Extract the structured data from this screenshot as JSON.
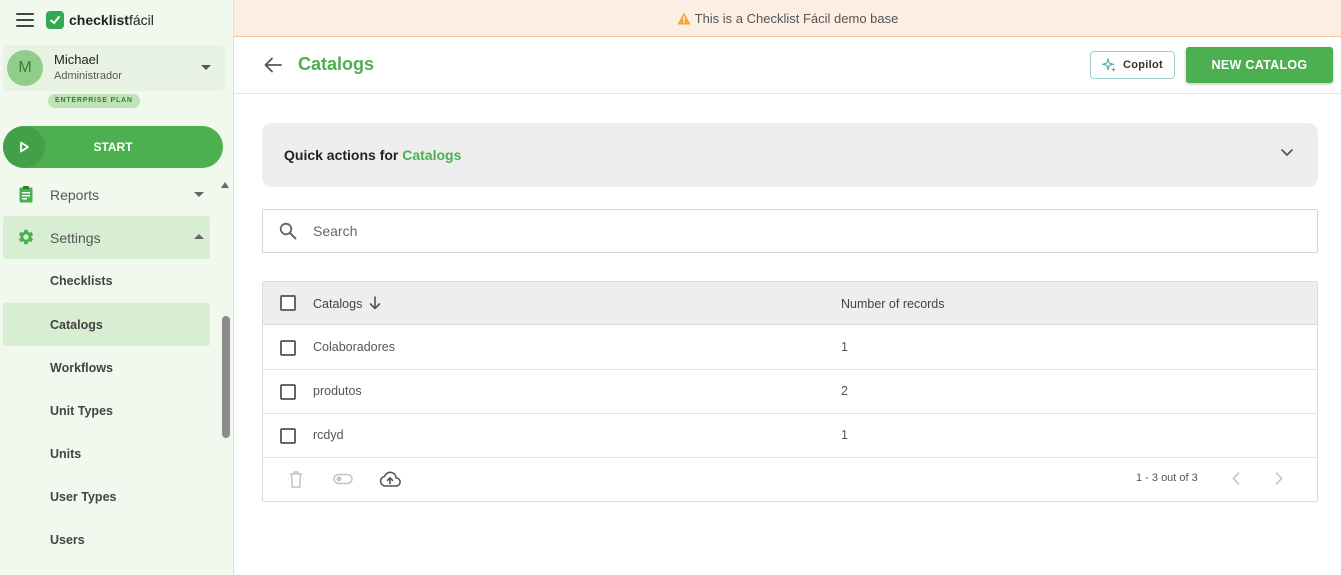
{
  "app": {
    "logo_bold": "checklist",
    "logo_light": "fácil"
  },
  "user": {
    "initial": "M",
    "name": "Michael",
    "role": "Administrador",
    "plan": "ENTERPRISE PLAN"
  },
  "start": {
    "label": "START"
  },
  "nav": {
    "reports": "Reports",
    "settings": "Settings",
    "settings_items": [
      "Checklists",
      "Catalogs",
      "Workflows",
      "Unit Types",
      "Units",
      "User Types",
      "Users"
    ]
  },
  "banner": {
    "text": "This is a Checklist Fácil demo base"
  },
  "header": {
    "title": "Catalogs",
    "copilot_label": "Copilot",
    "new_label": "NEW CATALOG"
  },
  "quick": {
    "prefix": "Quick actions for",
    "target": "Catalogs"
  },
  "search": {
    "placeholder": "Search",
    "value": ""
  },
  "table": {
    "columns": [
      "Catalogs",
      "Number of records"
    ],
    "rows": [
      {
        "name": "Colaboradores",
        "count": "1"
      },
      {
        "name": "produtos",
        "count": "2"
      },
      {
        "name": "rcdyd",
        "count": "1"
      }
    ],
    "pagination": "1 - 3 out of 3"
  },
  "colors": {
    "brand": "#4caf50",
    "banner_bg": "#fdeee3",
    "warning": "#f5a33a"
  },
  "icons": [
    "menu-icon",
    "chevron-down-icon",
    "play-icon",
    "clipboard-icon",
    "gear-icon",
    "warning-icon",
    "arrow-left-icon",
    "sparkle-icon",
    "search-icon",
    "arrow-down-icon",
    "trash-icon",
    "toggle-icon",
    "cloud-upload-icon",
    "chevron-left-icon",
    "chevron-right-icon"
  ]
}
